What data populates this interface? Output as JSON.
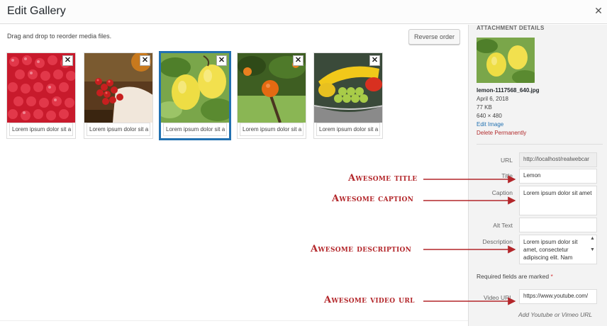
{
  "header": {
    "title": "Edit Gallery",
    "close_icon": "close-icon"
  },
  "toolbar": {
    "hint": "Drag and drop to reorder media files.",
    "reverse_label": "Reverse order"
  },
  "gallery": {
    "items": [
      {
        "caption": "Lorem ipsum dolor sit a",
        "remove": "✕"
      },
      {
        "caption": "Lorem ipsum dolor sit a",
        "remove": "✕"
      },
      {
        "caption": "Lorem ipsum dolor sit a",
        "remove": "✕"
      },
      {
        "caption": "Lorem ipsum dolor sit a",
        "remove": "✕"
      },
      {
        "caption": "Lorem ipsum dolor sit a",
        "remove": "✕"
      }
    ]
  },
  "details": {
    "heading": "ATTACHMENT DETAILS",
    "filename": "lemon-1117568_640.jpg",
    "date": "April 6, 2018",
    "size": "77 KB",
    "dimensions": "640 × 480",
    "edit_image": "Edit Image",
    "delete": "Delete Permanently",
    "fields": {
      "url_label": "URL",
      "url_value": "http://localhost/realwebcar",
      "title_label": "Title",
      "title_value": "Lemon",
      "caption_label": "Caption",
      "caption_value": "Lorem ipsum dolor sit amet",
      "alt_label": "Alt Text",
      "alt_value": "",
      "desc_label": "Description",
      "desc_value": "Lorem ipsum dolor sit amet, consectetur adipiscing elit. Nam",
      "required_text": "Required fields are marked",
      "required_star": "*",
      "video_label": "Video URL",
      "video_value": "https://www.youtube.com/",
      "video_help": "Add Youtube or Vimeo URL"
    }
  },
  "annotations": {
    "title": "Awesome title",
    "caption": "Awesome caption",
    "description": "Awesome description",
    "video": "Awesome video url"
  },
  "colors": {
    "accent": "#2271b1",
    "annotation": "#b3262a",
    "delete": "#b32d2e"
  }
}
